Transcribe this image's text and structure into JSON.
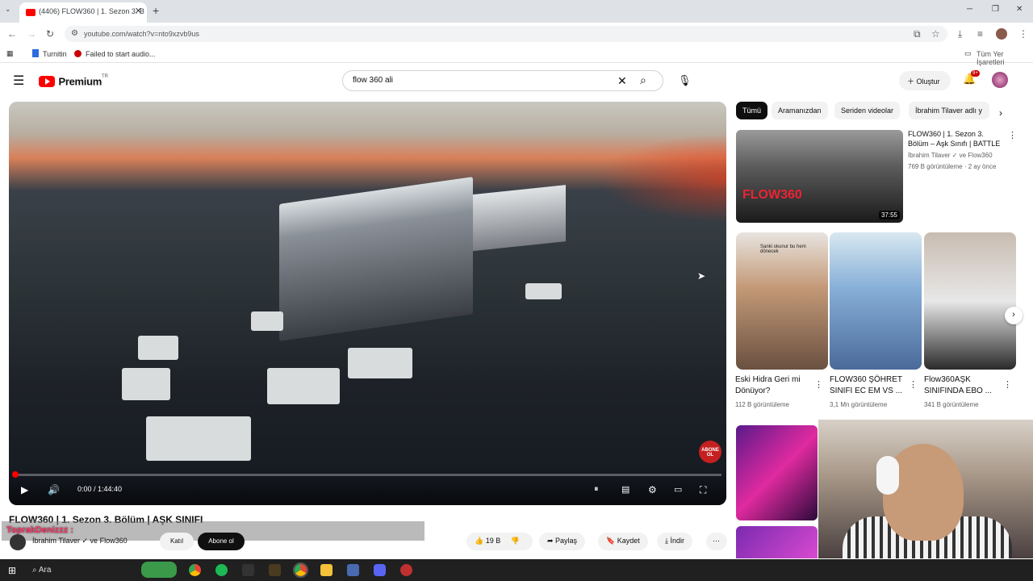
{
  "browser": {
    "tab_title": "(4406) FLOW360 | 1. Sezon 3. B",
    "tab_close": "✕",
    "new_tab": "+",
    "url": "youtube.com/watch?v=nto9xzvb9us",
    "bookmarks": [
      "Turnitin",
      "Failed to start audio..."
    ],
    "all_bookmarks": "Tüm Yer İşaretleri"
  },
  "masthead": {
    "logo_text": "Premium",
    "logo_sup": "TR",
    "search_value": "flow 360 ali",
    "create_label": "Oluştur",
    "notif_badge": "9+"
  },
  "player": {
    "timecode": "0:00 / 1:44:40",
    "progress": 0.0,
    "abone_label": "ABONE OL"
  },
  "video": {
    "title": "FLOW360 | 1. Sezon 3. Bölüm | AŞK SINIFI",
    "overlay_user": "ToprakDenizzz :",
    "channel": "İbrahim Tilaver ✓ ve Flow360",
    "join_label": "Katıl",
    "subscribe_label": "Abone ol",
    "likes": "19 B",
    "share_label": "Paylaş",
    "save_label": "Kaydet",
    "download_label": "İndir"
  },
  "sidebar": {
    "chips": [
      "Tümü",
      "Aramanızdan",
      "Seriden videolar",
      "İbrahim Tilaver adlı y"
    ],
    "rec": {
      "title": "FLOW360 | 1. Sezon 3. Bölüm – Aşk Sınıfı | BATTLE",
      "channel": "İbrahim Tilaver ✓ ve Flow360",
      "meta": "769 B görüntüleme · 2 ay önce",
      "duration": "37:55",
      "thumb_text": "FLOW360"
    },
    "shorts": [
      {
        "title": "Eski Hidra Geri mi Dönüyor?",
        "views": "112 B görüntüleme",
        "caption": "Sanki okunur bu hem dönecek"
      },
      {
        "title": "FLOW360 ŞÖHRET SINIFI EC EM VS ...",
        "views": "3,1 Mn görüntüleme",
        "caption": ""
      },
      {
        "title": "Flow360AŞK SINIFINDA EBO ...",
        "views": "341 B görüntüleme",
        "caption": ""
      }
    ]
  },
  "taskbar": {
    "search_placeholder": "Ara"
  },
  "colors": {
    "accent": "#ff0000",
    "subscribe_bg": "#0f0f0f",
    "taskbar_bg": "#202020"
  }
}
